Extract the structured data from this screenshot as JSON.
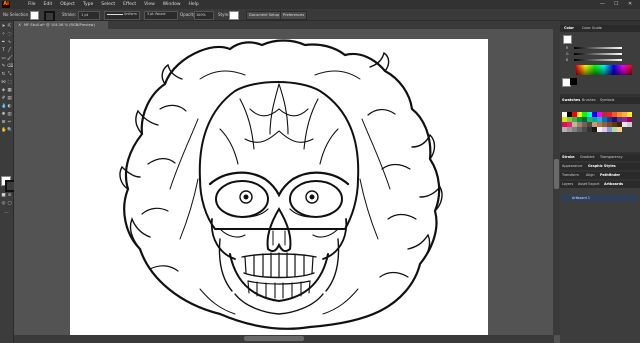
{
  "menubar": {
    "app_icon": "Ai",
    "items": [
      "File",
      "Edit",
      "Object",
      "Type",
      "Select",
      "Effect",
      "View",
      "Window",
      "Help"
    ],
    "window_controls": [
      "—",
      "☐",
      "✕"
    ]
  },
  "controlbar": {
    "selection_label": "No Selection",
    "stroke_label": "Stroke:",
    "stroke_weight": "1 pt",
    "brush_label": "Uniform",
    "brush_value": "3 pt. Round",
    "opacity_label": "Opacity:",
    "opacity_value": "100%",
    "style_label": "Style:",
    "doc_setup_label": "Document Setup",
    "preferences_label": "Preferences"
  },
  "document": {
    "tab_title": "MF Skull.ai* @ 104.56 % (RGB/Preview)"
  },
  "panels": {
    "color_tabs": [
      "Color",
      "Color Guide"
    ],
    "swatch_tabs": [
      "Swatches",
      "Brushes",
      "Symbols"
    ],
    "stroke_tabs": [
      "Stroke",
      "Gradient",
      "Transparency"
    ],
    "appearance_tabs": [
      "Appearance",
      "Graphic Styles"
    ],
    "transform_tabs": [
      "Transform",
      "Align",
      "Pathfinder"
    ],
    "layer_tabs": [
      "Layers",
      "Asset Export",
      "Artboards"
    ],
    "artboard_item": "Artboard 1",
    "slider_labels": [
      "R",
      "G",
      "B"
    ]
  },
  "colors": {
    "accent": "#ff9a00",
    "ui_dark": "#323232",
    "canvas_bg": "#535353",
    "artboard": "#ffffff"
  }
}
